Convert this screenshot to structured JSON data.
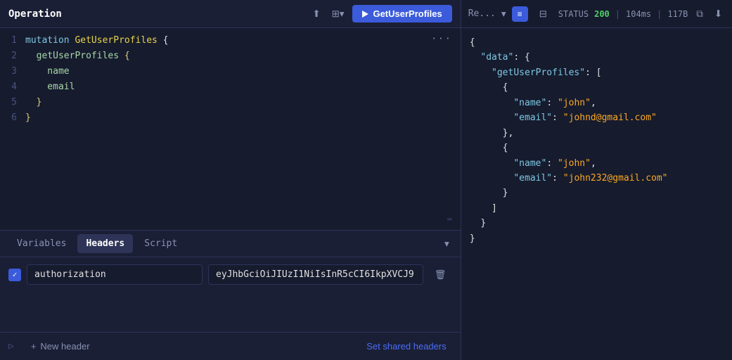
{
  "operation": {
    "title": "Operation",
    "run_button_label": "GetUserProfiles",
    "code_lines": [
      {
        "num": 1,
        "parts": [
          {
            "type": "kw",
            "text": "mutation "
          },
          {
            "type": "fn",
            "text": "GetUserProfiles"
          },
          {
            "type": "punct",
            "text": " {"
          }
        ]
      },
      {
        "num": 2,
        "parts": [
          {
            "type": "field",
            "text": "  getUserProfiles"
          },
          {
            "type": "brace",
            "text": " {"
          }
        ]
      },
      {
        "num": 3,
        "parts": [
          {
            "type": "field",
            "text": "    name"
          }
        ]
      },
      {
        "num": 4,
        "parts": [
          {
            "type": "field",
            "text": "    email"
          }
        ]
      },
      {
        "num": 5,
        "parts": [
          {
            "type": "brace",
            "text": "  }"
          }
        ]
      },
      {
        "num": 6,
        "parts": [
          {
            "type": "brace",
            "text": "}"
          }
        ]
      }
    ]
  },
  "tabs": {
    "items": [
      {
        "id": "variables",
        "label": "Variables",
        "active": false
      },
      {
        "id": "headers",
        "label": "Headers",
        "active": true
      },
      {
        "id": "script",
        "label": "Script",
        "active": false
      }
    ]
  },
  "headers": {
    "rows": [
      {
        "checked": true,
        "name": "authorization",
        "value": "eyJhbGciOiJIUzI1NiIsInR5cCI6IkpXVCJ9."
      }
    ],
    "add_label": "New header",
    "shared_label": "Set shared headers"
  },
  "response": {
    "title": "Re...",
    "status_code": "200",
    "time": "104ms",
    "size": "117B",
    "json_lines": [
      {
        "text": "{"
      },
      {
        "text": "  \"data\": {"
      },
      {
        "text": "    \"getUserProfiles\": ["
      },
      {
        "text": "      {"
      },
      {
        "text": "        \"name\": \"john\","
      },
      {
        "text": "        \"email\": \"johnd@gmail.com\""
      },
      {
        "text": "      },"
      },
      {
        "text": "      {"
      },
      {
        "text": "        \"name\": \"john\","
      },
      {
        "text": "        \"email\": \"john232@gmail.com\""
      },
      {
        "text": "      }"
      },
      {
        "text": "    ]"
      },
      {
        "text": "  }"
      },
      {
        "text": "}"
      }
    ]
  },
  "icons": {
    "share": "⬆",
    "layers": "⊞",
    "chevron_down": "▾",
    "list_view": "≡",
    "table_view": "⊟",
    "copy": "⧉",
    "download": "⬇",
    "trash": "🗑",
    "plus": "+",
    "dots": "···",
    "keyboard": "⌨",
    "collapse": "▾",
    "script_icon": "▷"
  }
}
